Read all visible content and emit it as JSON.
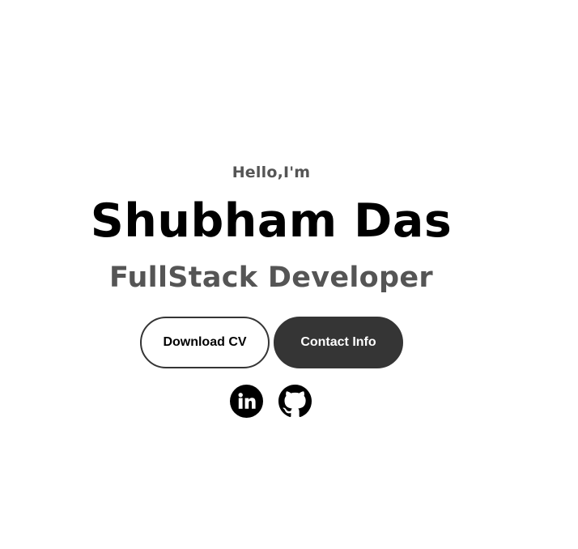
{
  "profile": {
    "greeting": "Hello,I'm",
    "name": "Shubham Das",
    "role": "FullStack Developer"
  },
  "buttons": {
    "download_cv": "Download CV",
    "contact_info": "Contact Info"
  },
  "social": {
    "icons": [
      "linkedin-icon",
      "github-icon"
    ]
  },
  "colors": {
    "background": "#ffffff",
    "primary_text": "#000000",
    "secondary_text": "#555555",
    "button_dark": "#353535"
  }
}
